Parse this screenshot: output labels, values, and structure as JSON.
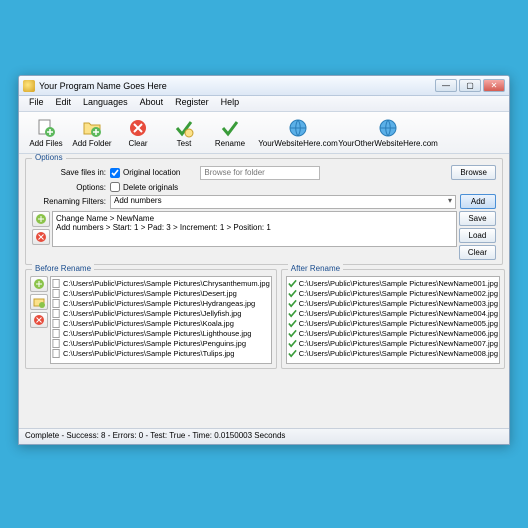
{
  "window": {
    "title": "Your Program Name Goes Here"
  },
  "menu": [
    "File",
    "Edit",
    "Languages",
    "About",
    "Register",
    "Help"
  ],
  "toolbar": [
    {
      "label": "Add Files"
    },
    {
      "label": "Add Folder"
    },
    {
      "label": "Clear"
    },
    {
      "label": "Test"
    },
    {
      "label": "Rename"
    },
    {
      "label": "YourWebsiteHere.com"
    },
    {
      "label": "YourOtherWebsiteHere.com"
    }
  ],
  "options": {
    "group_title": "Options",
    "save_files_label": "Save files in:",
    "original_location": "Original location",
    "options_label": "Options:",
    "delete_originals": "Delete originals",
    "renaming_filters_label": "Renaming Filters:",
    "selected_filter": "Add numbers",
    "browse_folder_placeholder": "Browse for folder",
    "browse_btn": "Browse",
    "add_btn": "Add",
    "save_btn": "Save",
    "load_btn": "Load",
    "clear_btn": "Clear",
    "filter_lines": [
      "Change Name > NewName",
      "Add numbers > Start: 1 > Pad: 3 > Increment: 1 > Position: 1"
    ]
  },
  "before": {
    "title": "Before Rename",
    "items": [
      "C:\\Users\\Public\\Pictures\\Sample Pictures\\Chrysanthemum.jpg",
      "C:\\Users\\Public\\Pictures\\Sample Pictures\\Desert.jpg",
      "C:\\Users\\Public\\Pictures\\Sample Pictures\\Hydrangeas.jpg",
      "C:\\Users\\Public\\Pictures\\Sample Pictures\\Jellyfish.jpg",
      "C:\\Users\\Public\\Pictures\\Sample Pictures\\Koala.jpg",
      "C:\\Users\\Public\\Pictures\\Sample Pictures\\Lighthouse.jpg",
      "C:\\Users\\Public\\Pictures\\Sample Pictures\\Penguins.jpg",
      "C:\\Users\\Public\\Pictures\\Sample Pictures\\Tulips.jpg"
    ]
  },
  "after": {
    "title": "After Rename",
    "items": [
      "C:\\Users\\Public\\Pictures\\Sample Pictures\\NewName001.jpg",
      "C:\\Users\\Public\\Pictures\\Sample Pictures\\NewName002.jpg",
      "C:\\Users\\Public\\Pictures\\Sample Pictures\\NewName003.jpg",
      "C:\\Users\\Public\\Pictures\\Sample Pictures\\NewName004.jpg",
      "C:\\Users\\Public\\Pictures\\Sample Pictures\\NewName005.jpg",
      "C:\\Users\\Public\\Pictures\\Sample Pictures\\NewName006.jpg",
      "C:\\Users\\Public\\Pictures\\Sample Pictures\\NewName007.jpg",
      "C:\\Users\\Public\\Pictures\\Sample Pictures\\NewName008.jpg"
    ]
  },
  "status": "Complete - Success: 8 - Errors: 0 - Test: True - Time: 0.0150003 Seconds"
}
